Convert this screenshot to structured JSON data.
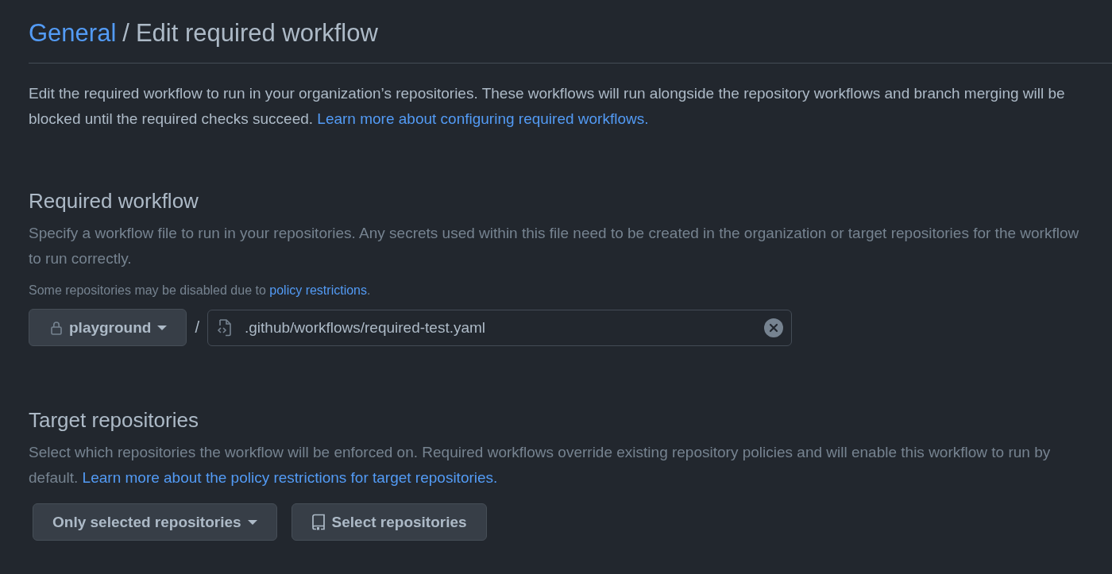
{
  "breadcrumb": {
    "parent": "General",
    "separator": "/",
    "current": "Edit required workflow"
  },
  "intro": {
    "text": "Edit the required workflow to run in your organization’s repositories. These workflows will run alongside the repository workflows and branch merging will be blocked until the required checks succeed.",
    "link": "Learn more about configuring required workflows."
  },
  "required_workflow": {
    "heading": "Required workflow",
    "description": "Specify a workflow file to run in your repositories. Any secrets used within this file need to be created in the organization or target repositories for the workflow to run correctly.",
    "note": {
      "text": "Some repositories may be disabled due to",
      "link": "policy restrictions",
      "suffix": "."
    },
    "repository_button": "playground",
    "separator": "/",
    "path_field": {
      "value": ".github/workflows/required-test.yaml"
    }
  },
  "target_repositories": {
    "heading": "Target repositories",
    "description": "Select which repositories the workflow will be enforced on. Required workflows override existing repository policies and will enable this workflow to run by default.",
    "link": "Learn more about the policy restrictions for target repositories.",
    "scope_dropdown": "Only selected repositories",
    "select_button": "Select repositories"
  }
}
